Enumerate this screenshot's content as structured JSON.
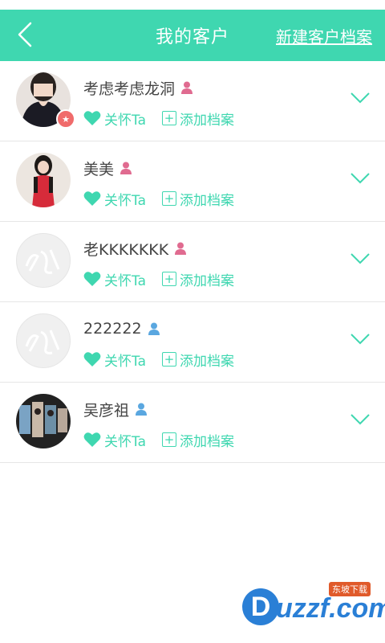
{
  "header": {
    "title": "我的客户",
    "new_link": "新建客户档案",
    "bg_color": "#3fd7b0"
  },
  "actions": {
    "care_label": "关怀Ta",
    "add_label": "添加档案"
  },
  "customers": [
    {
      "name": "考虑考虑龙洞",
      "gender": "female",
      "avatar": "photo-woman-dark",
      "badge": "star"
    },
    {
      "name": "美美",
      "gender": "female",
      "avatar": "photo-woman-red"
    },
    {
      "name": "老KKKKKKK",
      "gender": "female",
      "avatar": "placeholder-logo"
    },
    {
      "name": "222222",
      "gender": "male",
      "avatar": "placeholder-logo"
    },
    {
      "name": "吴彦祖",
      "gender": "male",
      "avatar": "photo-group"
    }
  ],
  "watermark": {
    "brand": "uzzf.com",
    "tag": "东坡下载",
    "letter": "D"
  }
}
